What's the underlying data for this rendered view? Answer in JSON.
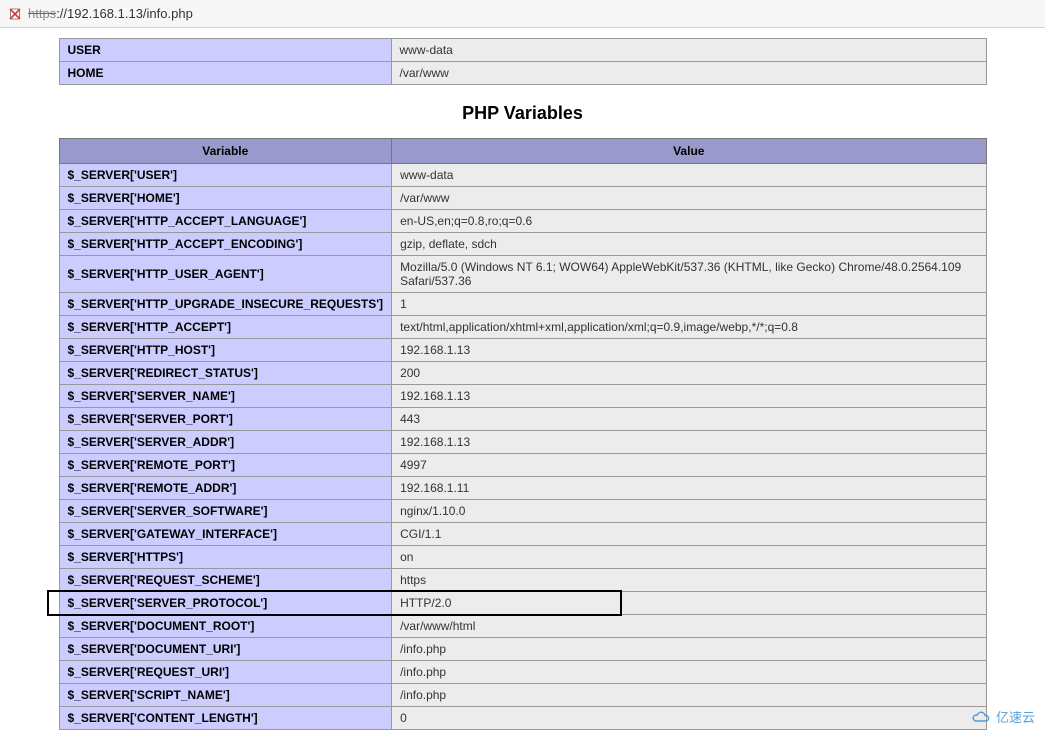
{
  "address_bar": {
    "https_label": "https",
    "url_rest": "://192.168.1.13/info.php"
  },
  "env_table": {
    "rows": [
      {
        "name": "USER",
        "value": "www-data"
      },
      {
        "name": "HOME",
        "value": "/var/www"
      }
    ]
  },
  "section_title": "PHP Variables",
  "vars_table": {
    "headers": {
      "variable": "Variable",
      "value": "Value"
    },
    "rows": [
      {
        "name": "$_SERVER['USER']",
        "value": "www-data"
      },
      {
        "name": "$_SERVER['HOME']",
        "value": "/var/www"
      },
      {
        "name": "$_SERVER['HTTP_ACCEPT_LANGUAGE']",
        "value": "en-US,en;q=0.8,ro;q=0.6"
      },
      {
        "name": "$_SERVER['HTTP_ACCEPT_ENCODING']",
        "value": "gzip, deflate, sdch"
      },
      {
        "name": "$_SERVER['HTTP_USER_AGENT']",
        "value": "Mozilla/5.0 (Windows NT 6.1; WOW64) AppleWebKit/537.36 (KHTML, like Gecko) Chrome/48.0.2564.109 Safari/537.36"
      },
      {
        "name": "$_SERVER['HTTP_UPGRADE_INSECURE_REQUESTS']",
        "value": "1"
      },
      {
        "name": "$_SERVER['HTTP_ACCEPT']",
        "value": "text/html,application/xhtml+xml,application/xml;q=0.9,image/webp,*/*;q=0.8"
      },
      {
        "name": "$_SERVER['HTTP_HOST']",
        "value": "192.168.1.13"
      },
      {
        "name": "$_SERVER['REDIRECT_STATUS']",
        "value": "200"
      },
      {
        "name": "$_SERVER['SERVER_NAME']",
        "value": "192.168.1.13"
      },
      {
        "name": "$_SERVER['SERVER_PORT']",
        "value": "443"
      },
      {
        "name": "$_SERVER['SERVER_ADDR']",
        "value": "192.168.1.13"
      },
      {
        "name": "$_SERVER['REMOTE_PORT']",
        "value": "4997"
      },
      {
        "name": "$_SERVER['REMOTE_ADDR']",
        "value": "192.168.1.11"
      },
      {
        "name": "$_SERVER['SERVER_SOFTWARE']",
        "value": "nginx/1.10.0"
      },
      {
        "name": "$_SERVER['GATEWAY_INTERFACE']",
        "value": "CGI/1.1"
      },
      {
        "name": "$_SERVER['HTTPS']",
        "value": "on"
      },
      {
        "name": "$_SERVER['REQUEST_SCHEME']",
        "value": "https"
      },
      {
        "name": "$_SERVER['SERVER_PROTOCOL']",
        "value": "HTTP/2.0",
        "highlighted": true
      },
      {
        "name": "$_SERVER['DOCUMENT_ROOT']",
        "value": "/var/www/html"
      },
      {
        "name": "$_SERVER['DOCUMENT_URI']",
        "value": "/info.php"
      },
      {
        "name": "$_SERVER['REQUEST_URI']",
        "value": "/info.php"
      },
      {
        "name": "$_SERVER['SCRIPT_NAME']",
        "value": "/info.php"
      },
      {
        "name": "$_SERVER['CONTENT_LENGTH']",
        "value": "0"
      }
    ]
  },
  "watermark": "亿速云"
}
